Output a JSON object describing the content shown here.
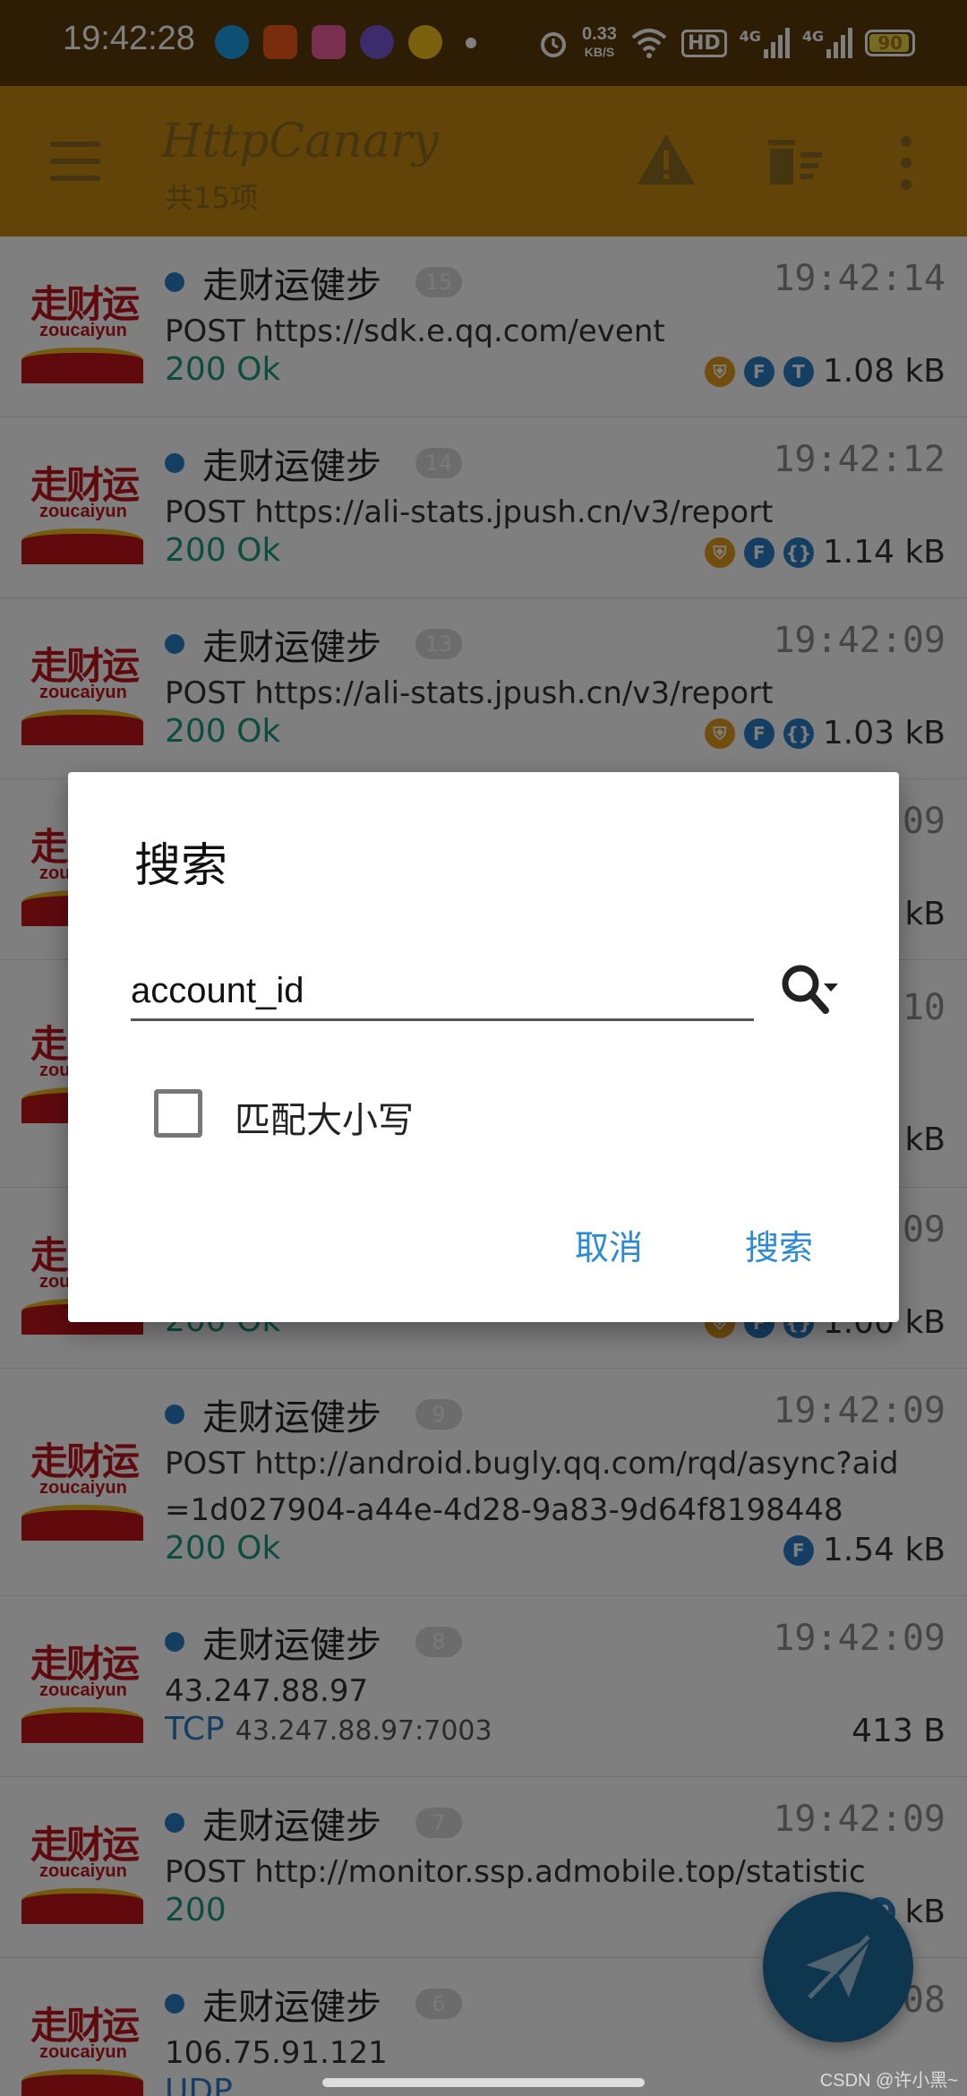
{
  "status_bar": {
    "time": "19:42:28",
    "speed_value": "0.33",
    "speed_unit": "KB/S",
    "hd_label": "HD",
    "signal_1": "4G",
    "signal_2": "4G",
    "battery": "90"
  },
  "app_bar": {
    "title": "HttpCanary",
    "subtitle": "共15项"
  },
  "requests": [
    {
      "app": "走财运健步",
      "num": "15",
      "time": "19:42:14",
      "url": "POST https://sdk.e.qq.com/event",
      "status": "200 Ok",
      "size": "1.08 kB",
      "badges": [
        "shield",
        "F",
        "T"
      ]
    },
    {
      "app": "走财运健步",
      "num": "14",
      "time": "19:42:12",
      "url": "POST https://ali-stats.jpush.cn/v3/report",
      "status": "200 Ok",
      "size": "1.14 kB",
      "badges": [
        "shield",
        "F",
        "{}"
      ]
    },
    {
      "app": "走财运健步",
      "num": "13",
      "time": "19:42:09",
      "url": "POST https://ali-stats.jpush.cn/v3/report",
      "status": "200 Ok",
      "size": "1.03 kB",
      "badges": [
        "shield",
        "F",
        "{}"
      ]
    },
    {
      "app": "",
      "num": "",
      "time": ":09",
      "url": "",
      "status": "",
      "size": "kB",
      "badges": []
    },
    {
      "app": "",
      "num": "",
      "time": ":10",
      "url": "",
      "status": "",
      "size": "kB",
      "badges": []
    },
    {
      "app": "",
      "num": "",
      "time": ":09",
      "url": "",
      "status": "200 Ok",
      "size": "1.00 kB",
      "badges": []
    },
    {
      "app": "走财运健步",
      "num": "9",
      "time": "19:42:09",
      "url": "POST http://android.bugly.qq.com/rqd/async?aid=1d027904-a44e-4d28-9a83-9d64f8198448",
      "status": "200 Ok",
      "size": "1.54 kB",
      "badges": [
        "F"
      ]
    },
    {
      "app": "走财运健步",
      "num": "8",
      "time": "19:42:09",
      "url": "43.247.88.97",
      "status": "TCP",
      "status_extra": "43.247.88.97:7003",
      "size": "413 B",
      "badges": []
    },
    {
      "app": "走财运健步",
      "num": "7",
      "time": "19:42:09",
      "url": "POST http://monitor.ssp.admobile.top/statistic",
      "status": "200",
      "size": "kB",
      "badges": [
        "{}"
      ]
    },
    {
      "app": "走财运健步",
      "num": "6",
      "time": ":08",
      "url": "106.75.91.121",
      "status": "UDP",
      "size": "",
      "badges": []
    }
  ],
  "logo": {
    "cn": "走财运",
    "en": "zoucaiyun"
  },
  "dialog": {
    "title": "搜索",
    "input_value": "account_id",
    "checkbox_label": "匹配大小写",
    "cancel_label": "取消",
    "search_label": "搜索"
  },
  "watermark": "CSDN @许小黑~",
  "colors": {
    "app_bar": "#c48810",
    "status_bar": "#5a3a08",
    "accent": "#2a8ad4",
    "status_ok": "#1a9a7a",
    "fab": "#1f6d9e"
  }
}
